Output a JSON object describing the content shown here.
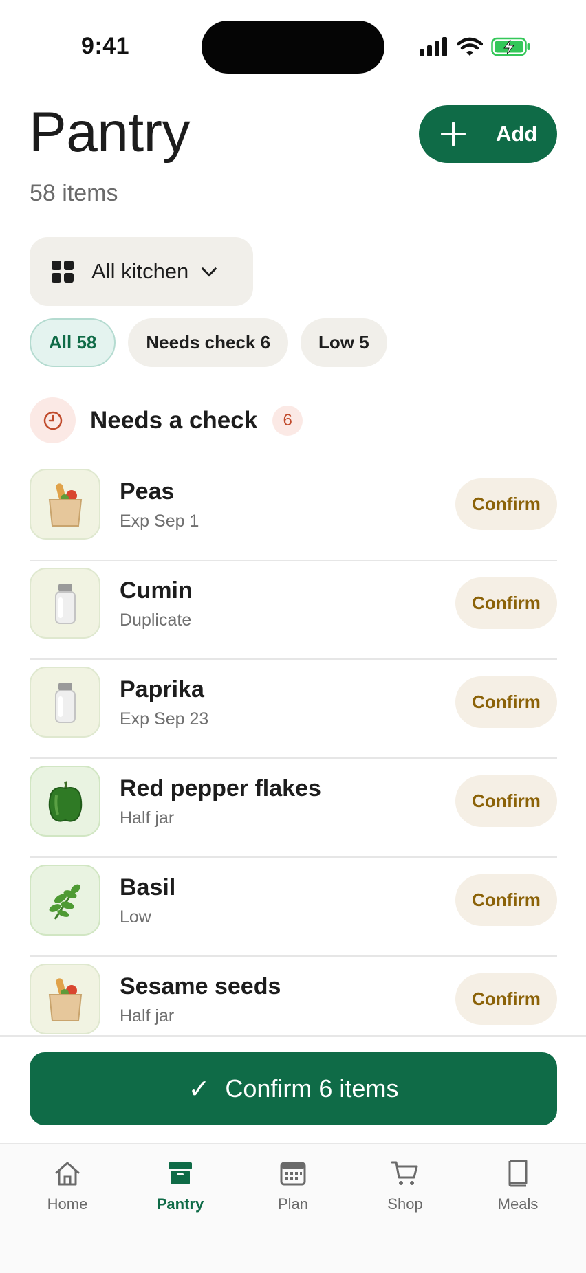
{
  "status_bar": {
    "time": "9:41"
  },
  "header": {
    "title": "Pantry",
    "subtitle": "58 items",
    "add_label": "Add"
  },
  "kitchen_selector": {
    "label": "All kitchen"
  },
  "filters": [
    {
      "label": "All 58",
      "active": true
    },
    {
      "label": "Needs check 6",
      "active": false
    },
    {
      "label": "Low 5",
      "active": false
    }
  ],
  "section": {
    "title": "Needs a check",
    "count": "6"
  },
  "items": [
    {
      "name": "Peas",
      "detail": "Exp Sep 1",
      "icon": "grocery-bag-icon",
      "action": "Confirm"
    },
    {
      "name": "Cumin",
      "detail": "Duplicate",
      "icon": "spice-shaker-icon",
      "action": "Confirm"
    },
    {
      "name": "Paprika",
      "detail": "Exp Sep 23",
      "icon": "spice-shaker-icon",
      "action": "Confirm"
    },
    {
      "name": "Red pepper flakes",
      "detail": "Half jar",
      "icon": "bell-pepper-icon",
      "action": "Confirm"
    },
    {
      "name": "Basil",
      "detail": "Low",
      "icon": "basil-leaf-icon",
      "action": "Confirm"
    },
    {
      "name": "Sesame seeds",
      "detail": "Half jar",
      "icon": "grocery-bag-icon",
      "action": "Confirm"
    }
  ],
  "confirm_all": {
    "label": "Confirm 6 items"
  },
  "tabbar": {
    "home": "Home",
    "pantry": "Pantry",
    "plan": "Plan",
    "shop": "Shop",
    "meals": "Meals"
  },
  "colors": {
    "brand": "#0f6b47",
    "confirm_text": "#8b6208",
    "alert": "#c04a2b"
  }
}
